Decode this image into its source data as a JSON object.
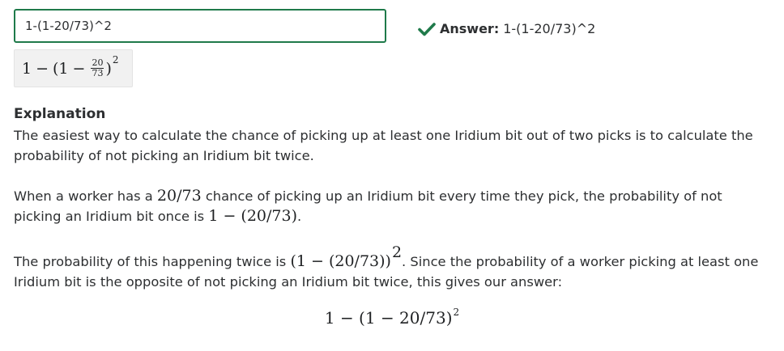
{
  "answer_input": {
    "value": "1-(1-20/73)^2"
  },
  "answer_status": {
    "icon": "check-icon",
    "icon_color": "#1f7a4a",
    "label": "Answer:",
    "value": "1-(1-20/73)^2"
  },
  "preview": {
    "one": "1",
    "minus": "−",
    "open": "(1",
    "minus2": "−",
    "frac_num": "20",
    "frac_den": "73",
    "close": ")",
    "exponent": "2"
  },
  "explanation": {
    "heading": "Explanation",
    "p1": "The easiest way to calculate the chance of picking up at least one Iridium bit out of two picks is to calculate the probability of not picking an Iridium bit twice.",
    "p2_a": "When a worker has a ",
    "p2_math1": "20/73",
    "p2_b": " chance of picking up an Iridium bit every time they pick, the probability of not picking an Iridium bit once is ",
    "p2_math2": "1 − (20/73)",
    "p2_c": ".",
    "p3_a": "The probability of this happening twice is ",
    "p3_math": "(1 − (20/73))",
    "p3_exp": "2",
    "p3_b": ". Since the probability of a worker picking at least one Iridium bit is the opposite of not picking an Iridium bit twice, this gives our answer:",
    "display_math": "1 − (1 − 20/73)",
    "display_exp": "2"
  },
  "colors": {
    "accent_green": "#1f7a4a",
    "text": "#2d2f31",
    "preview_bg": "#f1f1f1"
  }
}
